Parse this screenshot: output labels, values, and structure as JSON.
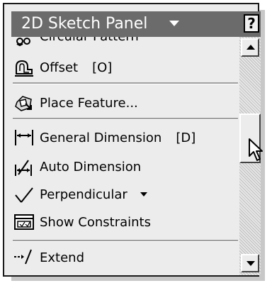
{
  "panel": {
    "title": "2D Sketch Panel",
    "help_label": "?"
  },
  "items": [
    {
      "label": "Circular Pattern",
      "shortcut": "",
      "icon": "circular-pattern-icon"
    },
    {
      "label": "Offset",
      "shortcut": "[O]",
      "icon": "offset-icon"
    },
    {
      "label": "Place Feature...",
      "shortcut": "",
      "icon": "place-feature-icon"
    },
    {
      "label": "General Dimension",
      "shortcut": "[D]",
      "icon": "general-dimension-icon"
    },
    {
      "label": "Auto Dimension",
      "shortcut": "",
      "icon": "auto-dimension-icon"
    },
    {
      "label": "Perpendicular",
      "shortcut": "",
      "icon": "perpendicular-icon",
      "has_dropdown": true
    },
    {
      "label": "Show Constraints",
      "shortcut": "",
      "icon": "show-constraints-icon"
    },
    {
      "label": "Extend",
      "shortcut": "",
      "icon": "extend-icon"
    }
  ],
  "colors": {
    "titlebar": "#6b6b6b",
    "panel_bg": "#ececec"
  }
}
